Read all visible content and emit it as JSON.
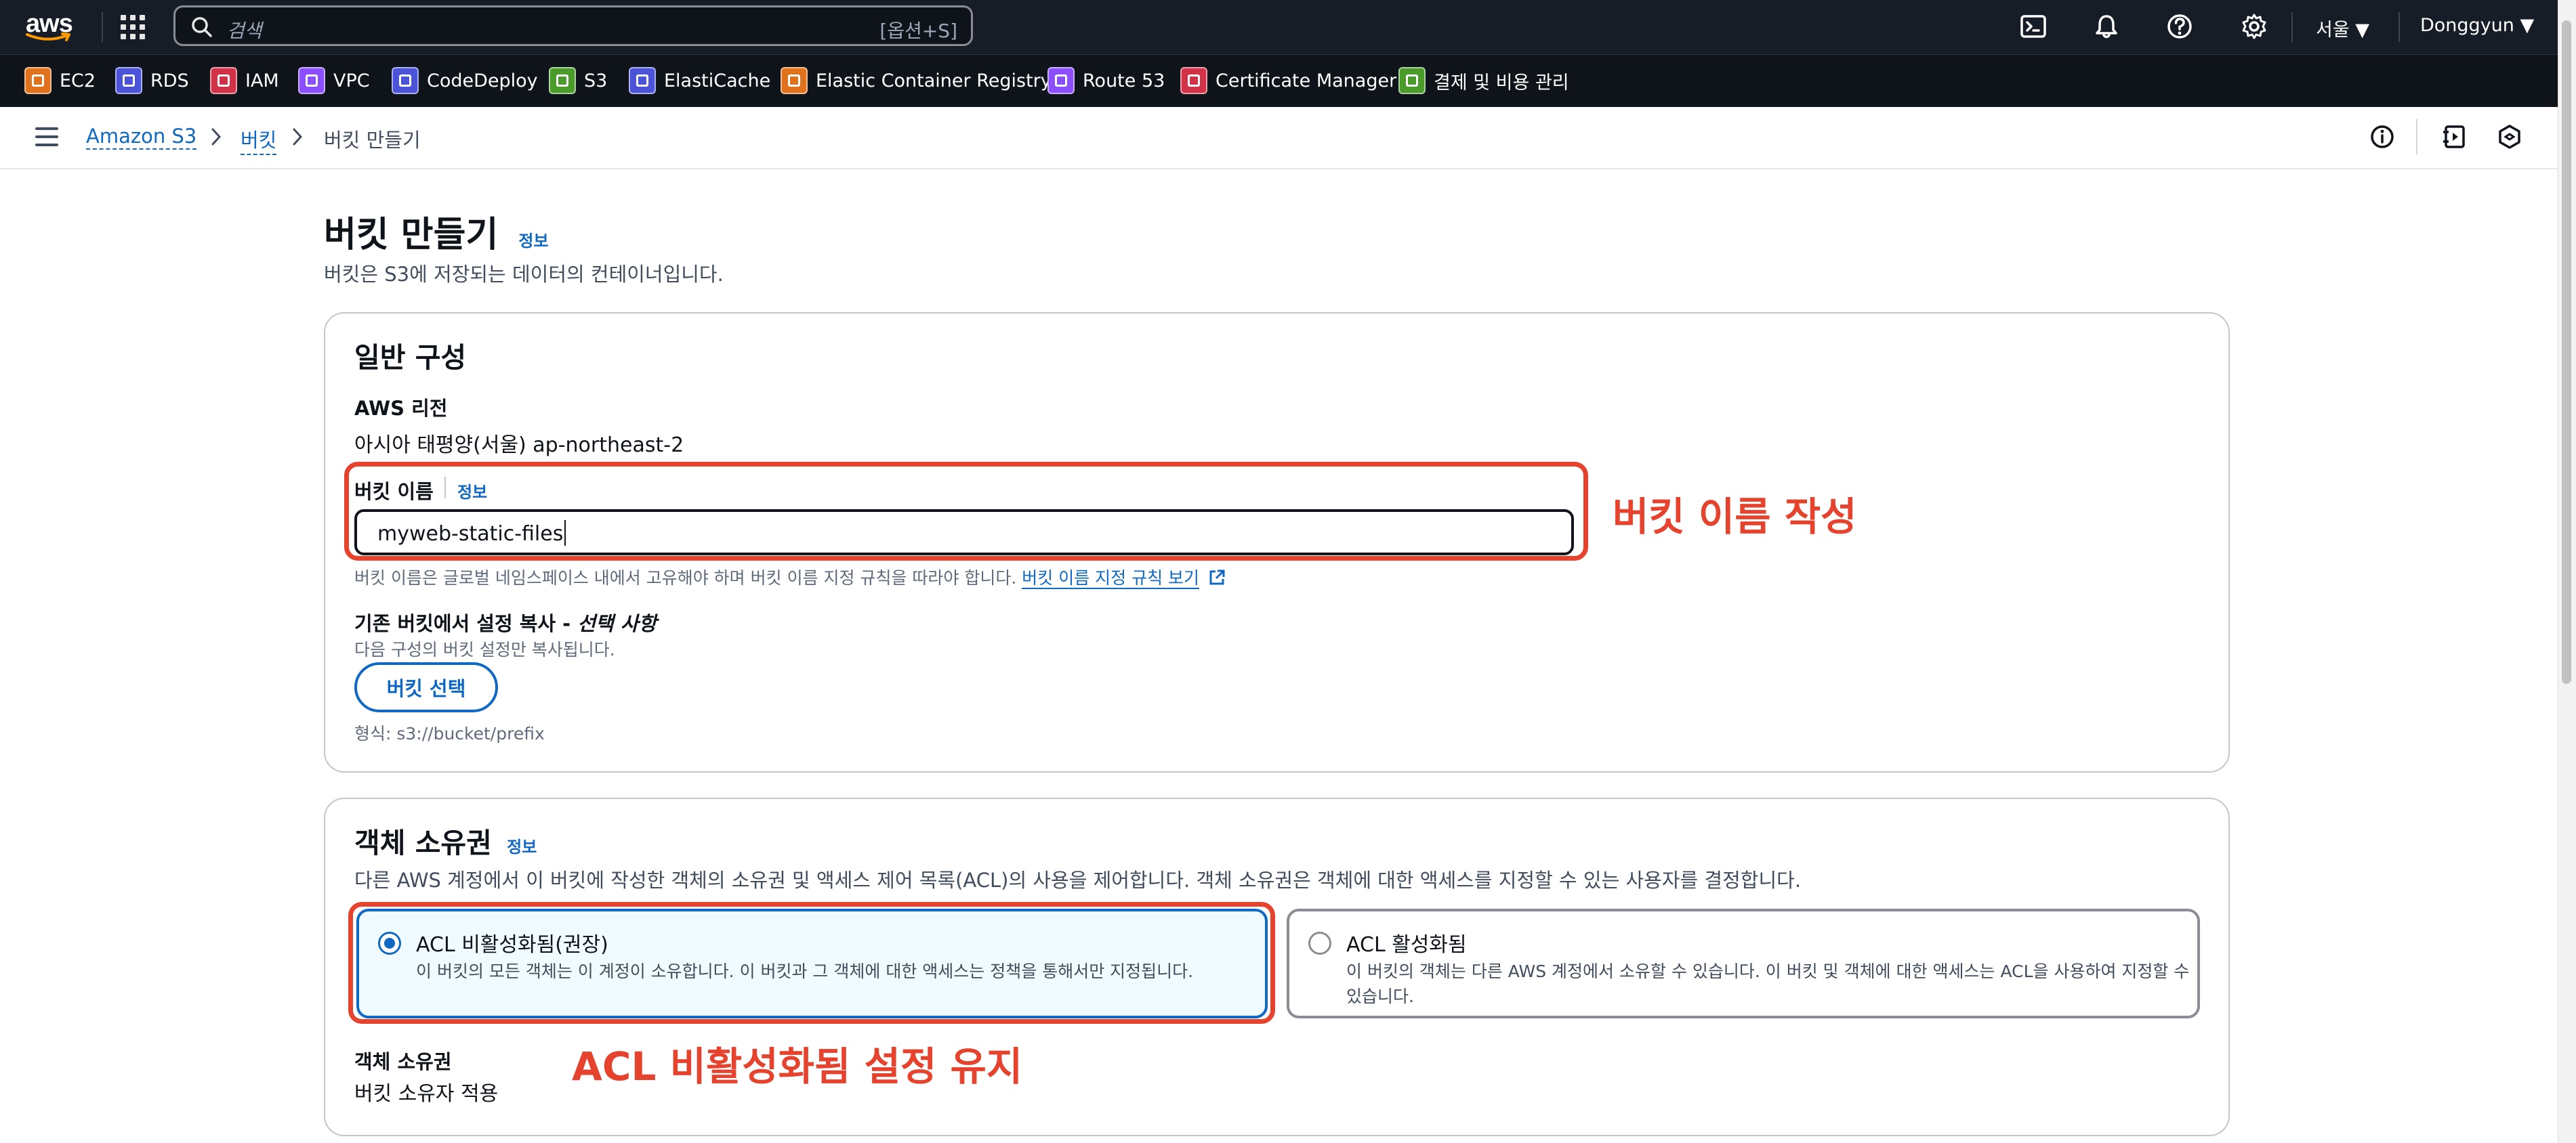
{
  "topbar": {
    "logo_text": "aws",
    "search_placeholder": "검색",
    "search_shortcut": "[옵션+S]",
    "region": "서울 ▼",
    "user": "Donggyun ▼"
  },
  "services": [
    {
      "label": "EC2",
      "color": "#e0721b"
    },
    {
      "label": "RDS",
      "color": "#4b53d9"
    },
    {
      "label": "IAM",
      "color": "#d13248"
    },
    {
      "label": "VPC",
      "color": "#8c4fff"
    },
    {
      "label": "CodeDeploy",
      "color": "#4b53d9"
    },
    {
      "label": "S3",
      "color": "#4a9b2a"
    },
    {
      "label": "ElastiCache",
      "color": "#4b53d9"
    },
    {
      "label": "Elastic Container Registry",
      "color": "#e0721b"
    },
    {
      "label": "Route 53",
      "color": "#8c4fff"
    },
    {
      "label": "Certificate Manager",
      "color": "#d13248"
    },
    {
      "label": "결제 및 비용 관리",
      "color": "#4a9b2a"
    }
  ],
  "breadcrumb": {
    "root": "Amazon S3",
    "level1": "버킷",
    "current": "버킷 만들기"
  },
  "page": {
    "title": "버킷 만들기",
    "info": "정보",
    "subtitle": "버킷은 S3에 저장되는 데이터의 컨테이너입니다."
  },
  "general": {
    "heading": "일반 구성",
    "region_label": "AWS 리전",
    "region_value": "아시아 태평양(서울) ap-northeast-2",
    "name_label": "버킷 이름",
    "name_info": "정보",
    "name_value": "myweb-static-files",
    "name_hint": "버킷 이름은 글로벌 네임스페이스 내에서 고유해야 하며 버킷 이름 지정 규칙을 따라야 합니다.",
    "name_rules_link": "버킷 이름 지정 규칙 보기",
    "copy_label_main": "기존 버킷에서 설정 복사 - ",
    "copy_label_opt": "선택 사항",
    "copy_hint": "다음 구성의 버킷 설정만 복사됩니다.",
    "choose_button": "버킷 선택",
    "format_hint": "형식: s3://bucket/prefix"
  },
  "ownership": {
    "heading": "객체 소유권",
    "info": "정보",
    "description": "다른 AWS 계정에서 이 버킷에 작성한 객체의 소유권 및 액세스 제어 목록(ACL)의 사용을 제어합니다. 객체 소유권은 객체에 대한 액세스를 지정할 수 있는 사용자를 결정합니다.",
    "option1_title": "ACL 비활성화됨(권장)",
    "option1_desc": "이 버킷의 모든 객체는 이 계정이 소유합니다. 이 버킷과 그 객체에 대한 액세스는 정책을 통해서만 지정됩니다.",
    "option1_selected": true,
    "option2_title": "ACL 활성화됨",
    "option2_desc_line1": "이 버킷의 객체는 다른 AWS 계정에서 소유할 수 있습니다. 이 버킷 및 객체에 대한 액세스는 ACL을 사용하여 지정할 수",
    "option2_desc_line2": "있습니다.",
    "owner_label": "객체 소유권",
    "owner_value": "버킷 소유자 적용"
  },
  "annotations": {
    "name_note": "버킷 이름 작성",
    "acl_note": "ACL 비활성화됨 설정 유지",
    "color": "#e5432e"
  },
  "colors": {
    "link": "#0f68c4",
    "topbar": "#161d26",
    "selected_bg": "#f0fbff"
  }
}
